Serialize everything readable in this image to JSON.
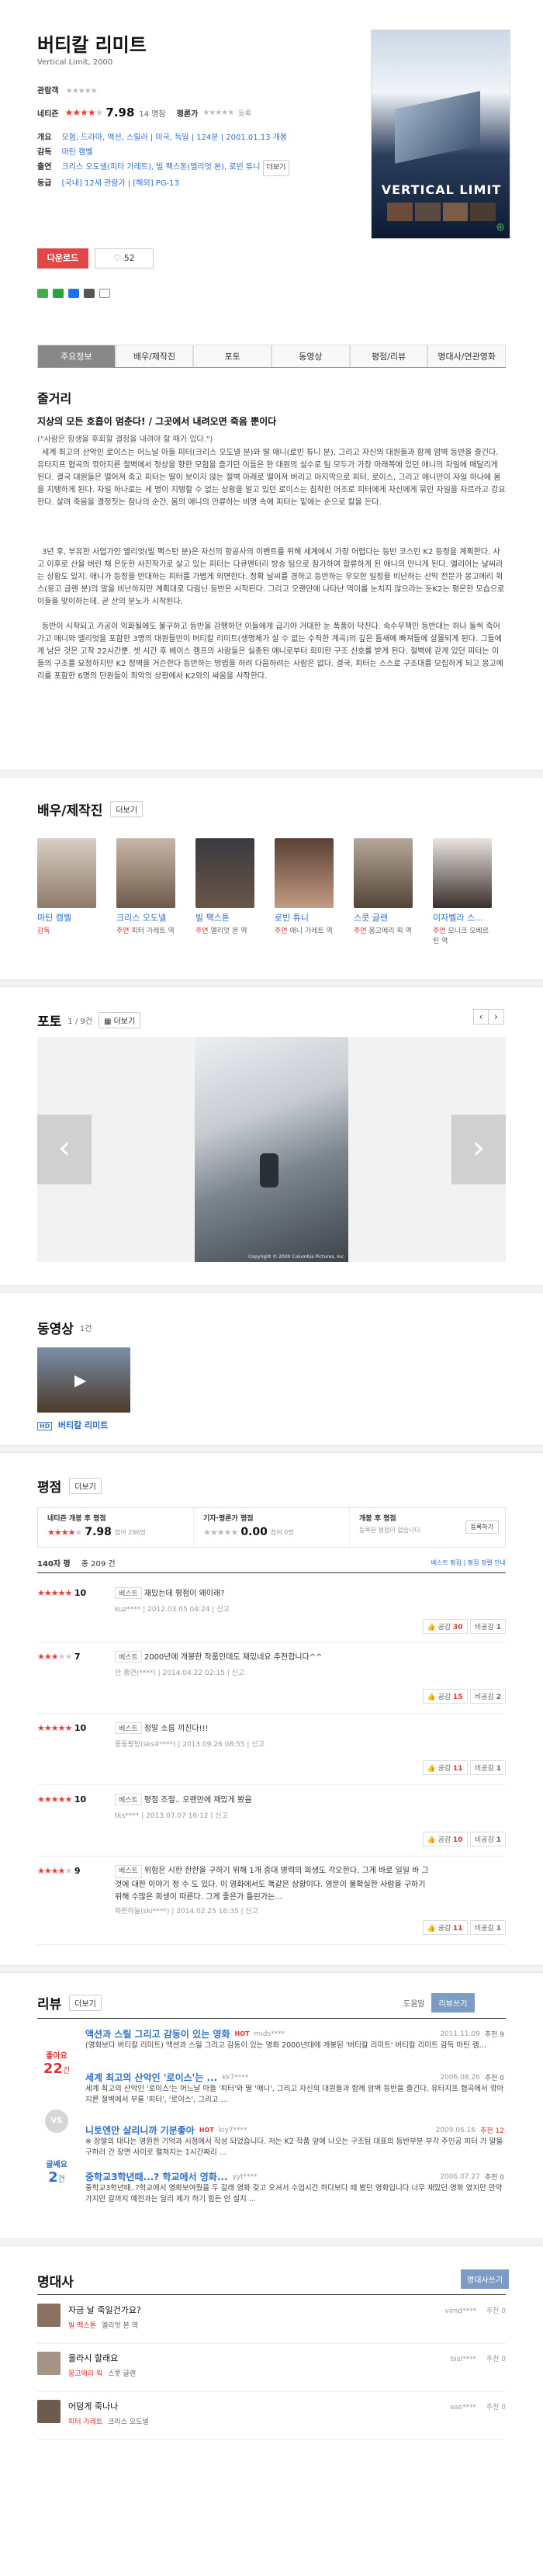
{
  "movie": {
    "title_ko": "버티칼 리미트",
    "title_en": "Vertical Limit, 2000",
    "viewer_label": "관람객",
    "netizen_label": "네티즌",
    "netizen_score": "7.98",
    "netizen_count": "14 명참",
    "critic_label": "평론가",
    "critic_note": "등록",
    "info": [
      {
        "k": "개요",
        "v": "모험, 드라마, 액션, 스릴러 | 미국, 독일 | 124분 | 2001.01.13 개봉"
      },
      {
        "k": "감독",
        "v": "마틴 캠벨"
      },
      {
        "k": "출연",
        "v": "크리스 오도넬(피터 가레트), 빌 팩스톤(엘리엇 본), 로빈 튜니",
        "more": "더보기"
      },
      {
        "k": "등급",
        "v": "[국내] 12세 관람가 | [해외] PG-13"
      }
    ],
    "download_label": "다운로드",
    "like_count": "52",
    "poster_text": "VERTICAL LIMIT"
  },
  "tabs": [
    "주요정보",
    "배우/제작진",
    "포토",
    "동영상",
    "평점/리뷰",
    "명대사/연관영화"
  ],
  "synopsis": {
    "title": "줄거리",
    "headline": "지상의 모든 호흡이 멈춘다! / 그곳에서 내려오면 죽음 뿐이다",
    "quote": "(\"사람은 항생을 후회할 결정을 내려야 할 때가 있다.\")",
    "paragraphs": [
      "세계 최고의 산악인 로이스는 어느날 아들 피터(크리스 오도넬 분)와 딸 애니(로빈 튜니 분), 그리고 자신의 대원들과 함께 암벽 등반을 즐긴다. 유타지프 협곡의 깎아지른 절벽에서 정상을 향한 모험을 즐기던 이들은 한 대원의 실수로 팀 모두가 가장 아래쪽에 있던 애니의 자일에 매달리게 된다. 결국 대원들은 떨어져 죽고 피터는 딸이 보이지 않는 절벽 아래로 떨어져 버리고 마지막으로 피터, 로이스, 그리고 애니만이 자일 하나에 몸을 지탱하게 된다. 자일 하나로는 세 명이 지탱할 수 없는 상황을 알고 있던 로이스는 침착한 어조로 피터에게 자신에게 묶인 자일을 자르라고 강요한다. 살려 죽음을 결정짓는 참나의 순간, 몸의 애니의 만류하는 비명 속에 피터는 밑에는 순으로 칼을 든다.",
      "3년 후, 부유한 사업가인 엘리엇(빌 팩스턴 분)은 자신의 항공사의 이벤트를 위해 세계에서 가장 어렵다는 등반 코스인 K2 등정을 계획한다. 사고 이후로 산을 버린 채 은둔한 사진작가로 살고 있는 피터는 다큐멘터리 방송 팀으로 참가하여 합류하게 된 애니의 만니게 된다. 엘리어는 날씨라는 상황도 있지. 애니가 등정을 반대하는 피터를 가볍게 외면한다. 정확 날씨를 경하고 등반하는 무모한 일정을 비난하는 산악 전문가 몽고메리 윅스(몽고 글렌 분)의 말을 비난하지만 계획대로 다림닌 등반은 시작된다. 그리고 오랜만에 나타난 먹이를 눈치지 않으라는 둔K2는 평온한 모습으로 이들을 맞이하는데. 곧 산의 분노가 시작된다.",
      "등반이 시작되고 가공이 익화될에도 불구하고 등반을 강행하던 이들에게 급기야 거대한 눈 폭풍이 닥친다. 속수무책인 등반대는 하나 둘씩 죽어가고 애니와 엘리엇을 포함한 3명의 대원들만이 버티칼 리미트(생명체가 살 수 없는 수직한 계곡)의 깊은 틈새에 빠져들에 살몰되게 된다. 그들에게 남은 것은 고작 22시간뿐. 셋 시간 후 베이스 캠프의 사람들은 실종된 애니로부터 희미한 구조 신호를 받게 된다. 절벽에 갇게 있던 피터는 이들의 구조를 요청하지만 K2 정벽을 거슨한다 등반하는 방법을 하려 다음하려는 사람은 없다. 결국, 피터는 스스로 구조대를 모집하게 되고 몽고메리를 포함한 6명의 단원들이 최악의 상황에서 K2와의 싸움을 시작한다."
    ]
  },
  "cast": {
    "title": "배우/제작진",
    "more": "더보기",
    "people": [
      {
        "name": "마틴 캠벨",
        "role": "감독",
        "char": ""
      },
      {
        "name": "크리스 오도넬",
        "role": "주연",
        "char": "피터 가레트 역"
      },
      {
        "name": "빌 팩스톤",
        "role": "주연",
        "char": "엘리엇 본 역"
      },
      {
        "name": "로빈 튜니",
        "role": "주연",
        "char": "애니 가레트 역"
      },
      {
        "name": "스콧 글렌",
        "role": "주연",
        "char": "몽고메리 윅 역"
      },
      {
        "name": "이자벨라 스...",
        "role": "주연",
        "char": "모니크 오베르틴 역"
      }
    ]
  },
  "photo": {
    "title": "포토",
    "count": "1 / 9건",
    "more": "더보기",
    "caption": "Copyright © 2000 Columbia Pictures, Inc."
  },
  "video": {
    "title": "동영상",
    "count": "1건",
    "hd": "HD",
    "label": "버티칼 리미트"
  },
  "rating": {
    "title": "평점",
    "more": "더보기",
    "box1_label": "네티즌 개봉 후 평점",
    "box1_score": "7.98",
    "box1_count": "참여 286명",
    "box2_label": "기자·평론가 평점",
    "box2_score": "0.00",
    "box2_count": "참여 0명",
    "box3_label": "개봉 후 평점",
    "box3_desc": "등록된 평점이 없습니다.",
    "box3_btn": "등록하기",
    "total_label": "140자 평",
    "total_count": "총 209 건",
    "sort": "베스트 평점 | 평점 정렬 안내",
    "reviews": [
      {
        "score": "10",
        "text": "재밌는데 평점이 왜이래?",
        "user": "kuz****",
        "date": "2012.03.05 04:24",
        "report": "신고",
        "up": "30",
        "down": "1"
      },
      {
        "score": "7",
        "text": "2000년에 개봉한 작품인데도 재밌네요 추천합니다^^",
        "user": "안 총연(****)",
        "date": "2014.04.22 02:15",
        "report": "신고",
        "up": "15",
        "down": "2"
      },
      {
        "score": "10",
        "text": "정말 소름 끼친다!!!",
        "user": "몽둥팡탕(sks4****)",
        "date": "2013.09.26 08:55",
        "report": "신고",
        "up": "11",
        "down": "1"
      },
      {
        "score": "10",
        "text": "평점 조절.. 오랜만에 재밌게 봤음",
        "user": "tks****",
        "date": "2013.07.07 16:12",
        "report": "신고",
        "up": "10",
        "down": "1"
      },
      {
        "score": "9",
        "text": "위험은 시한 한한을 구하기 위해 1개 중대 병력의 희생도 각오한다. 그게 바로 일일 바 그것에 대한 이야기 정 수 도 있다. 이 영화에서도 똑같은 상황이다. 영문이 불확실한 사람을 구하기 위해 수많은 희생이 따른다. 그게 좋은가 틀린가는...",
        "user": "파란하늘(ski****)",
        "date": "2014.02.25 16:35",
        "report": "신고",
        "up": "11",
        "down": "1"
      }
    ]
  },
  "review": {
    "title": "리뷰",
    "more": "더보기",
    "sort_label": "도움말",
    "write": "리뷰쓰기",
    "good_label": "좋아요",
    "good_count": "22",
    "bad_label": "글쎄요",
    "bad_count": "2",
    "unit": "건",
    "vs": "VS",
    "items": [
      {
        "title": "액션과 스릴 그리고 감동이 있는 영화",
        "badge": "HOT",
        "user": "mids****",
        "date": "2011.11.09",
        "likes": "추천 9",
        "desc": "(영화보다 버티칼 리미트) 액션과 스릴 그리고 감동이 있는 영화 2000년대에 개봉된 '버티칼 리미트' 버티칼 리미트 감독 마틴 캠..."
      },
      {
        "title": "세계 최고의 산악인 '로이스'는 ...",
        "badge": "",
        "user": "kk7****",
        "date": "2006.08.26",
        "likes": "추천 0",
        "desc": "세계 최고의 산악인 '로이스'는 어느날 아들 '피터'와 딸 '애니', 그리고 자신의 대원들과 함께 암벽 등반을 즐긴다. 유타지프 협곡에서 깎아지른 절벽에서 부를 '피터', '로이스', 그리고 ..."
      },
      {
        "title": "니토엔만 살리니까 기분좋아",
        "badge": "HOT",
        "user": "kiy7****",
        "date": "2009.06.16",
        "likes": "추천 12",
        "desc": "※ 장발의 대다는 영원한 기억과 시점에서 작성 되었습니다. 저는 K2 작품 앞에 나오는 구조팀 대표의 등반부분 부각 주인공 피터 가 말을 구하러 간 장면 사이로 펼쳐지는 1시간짜리 ..."
      },
      {
        "title": "중학교3학년때...? 학교에서 영화...",
        "badge": "",
        "user": "yyt****",
        "date": "2006.07.27",
        "likes": "추천 0",
        "desc": "중학교3학년때..?학교에서 영화보여줬을 두 갈래 영화 갖고 오셔서 수업시간 하다보다 때 봤던 영화입니다 너무 재밌던 영화 였지만 만약 가지만 갈까지 예전과는 달리 제가 하기 힘든 안 설치 ..."
      }
    ]
  },
  "quotes": {
    "title": "명대사",
    "write": "명대사쓰기",
    "items": [
      {
        "text": "자금 날 죽일건가요?",
        "actor": "빌 팩스톤",
        "role": "엘리엇 본 역",
        "user": "vimd****",
        "likes": "추천 0"
      },
      {
        "text": "올라시 할래요",
        "actor": "몽고메리 윅",
        "role": "스콧 글렌",
        "user": "bisl****",
        "likes": "추천 0"
      },
      {
        "text": "어덩게 죽나나",
        "actor": "피터 가레트",
        "role": "크리스 오도넬",
        "user": "eas****",
        "likes": "추천 0"
      }
    ]
  }
}
